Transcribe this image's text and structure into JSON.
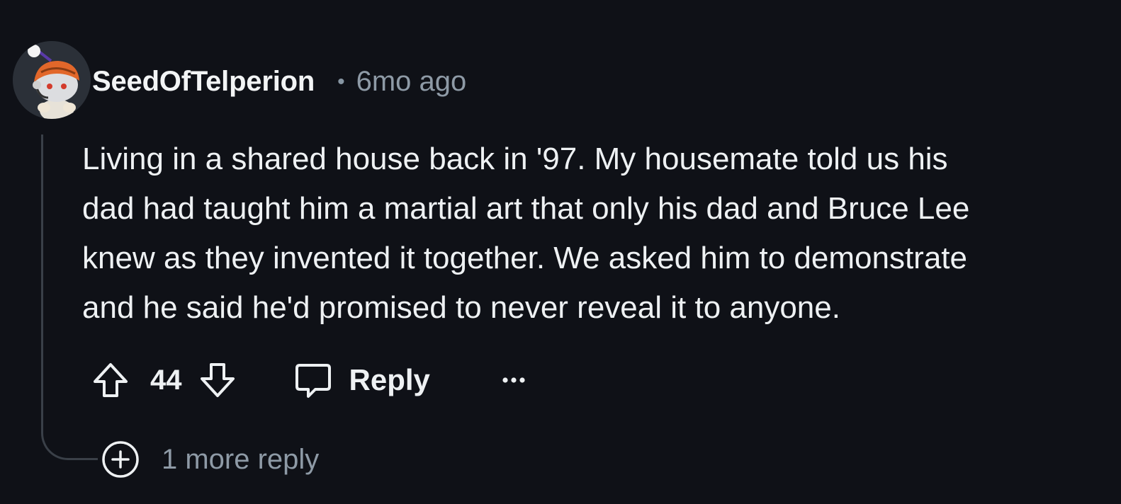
{
  "comment": {
    "author": "SeedOfTelperion",
    "separator": "•",
    "timestamp": "6mo ago",
    "body_lines": [
      "Living in a shared house back in '97. My housemate told us his",
      "dad had taught him a martial art that only his dad and Bruce Lee",
      "knew as they invented it together. We asked him to demonstrate",
      "and he said he'd promised to never reveal it to anyone."
    ],
    "score": "44",
    "reply_label": "Reply",
    "more_replies_label": "1 more reply"
  },
  "icons": {
    "avatar": "reddit-snoo-avatar",
    "upvote": "upvote-arrow-icon",
    "downvote": "downvote-arrow-icon",
    "reply": "speech-bubble-icon",
    "more": "ellipsis-icon",
    "expand": "plus-circle-icon"
  },
  "colors": {
    "background": "#0f1117",
    "text": "#eef1f3",
    "muted": "#8e9aa6",
    "thread_line": "#3a4048"
  }
}
